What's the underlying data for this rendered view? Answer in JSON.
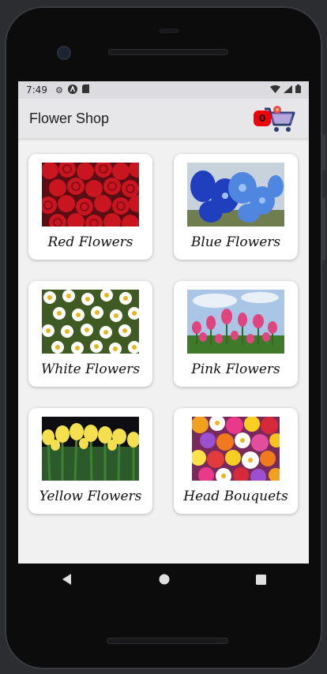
{
  "status_bar": {
    "time": "7:49"
  },
  "app_bar": {
    "title": "Flower Shop",
    "cart_count": "0"
  },
  "categories": [
    {
      "label": "Red Flowers",
      "icon": "red-roses-image"
    },
    {
      "label": "Blue Flowers",
      "icon": "blue-orchids-image"
    },
    {
      "label": "White Flowers",
      "icon": "white-daisies-image"
    },
    {
      "label": "Pink Flowers",
      "icon": "pink-tulips-image"
    },
    {
      "label": "Yellow Flowers",
      "icon": "yellow-tulips-image"
    },
    {
      "label": "Head Bouquets",
      "icon": "mixed-flowers-image"
    }
  ],
  "colors": {
    "app_bar": "#e7e7ea",
    "badge": "#f4000a",
    "cart": "#2c3e73",
    "background": "#f1f1f1"
  }
}
